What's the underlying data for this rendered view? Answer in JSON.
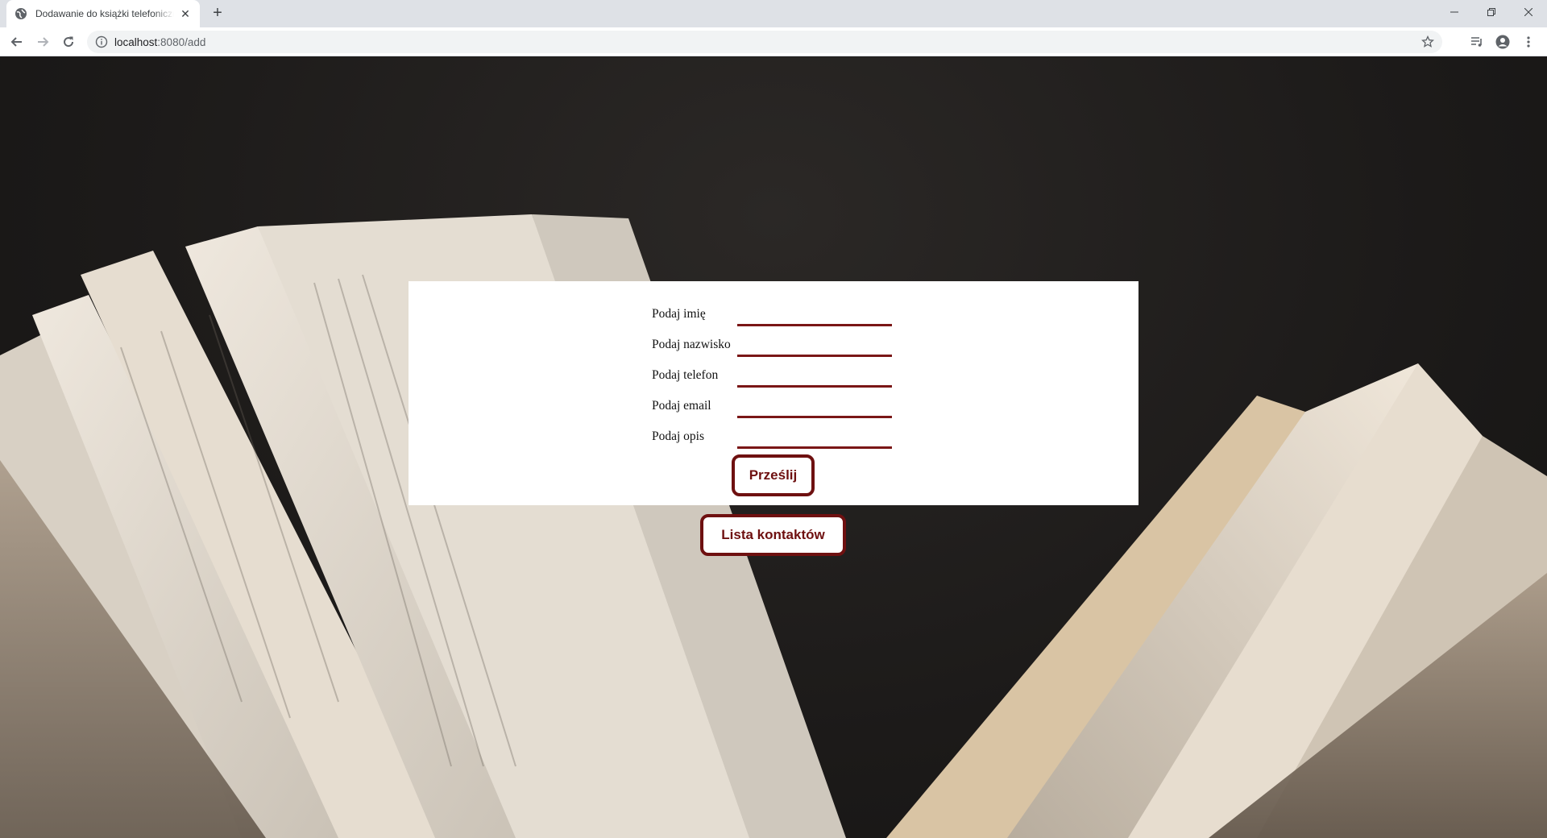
{
  "browser": {
    "tab_title": "Dodawanie do książki telefonicznej",
    "url_host": "localhost",
    "url_path": ":8080/add",
    "new_tab_symbol": "+",
    "tab_close_symbol": "✕"
  },
  "form": {
    "fields": [
      {
        "label": "Podaj imię",
        "value": ""
      },
      {
        "label": "Podaj nazwisko",
        "value": ""
      },
      {
        "label": "Podaj telefon",
        "value": ""
      },
      {
        "label": "Podaj email",
        "value": ""
      },
      {
        "label": "Podaj opis",
        "value": ""
      }
    ],
    "submit_label": "Prześlij"
  },
  "links": {
    "contacts_label": "Lista kontaktów"
  },
  "colors": {
    "accent": "#6e1010",
    "card": "#ffffff",
    "background": "#1e1c1b"
  }
}
